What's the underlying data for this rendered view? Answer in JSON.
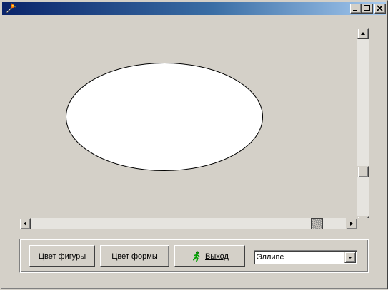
{
  "window": {
    "title": "",
    "controls": [
      "minimize",
      "maximize",
      "close"
    ]
  },
  "drawing_area": {
    "shape": "Ellipse",
    "fill_color": "#ffffff",
    "outline_color": "#000000"
  },
  "scrollbars": {
    "vertical": {
      "thumb_position_fraction": 0.8
    },
    "horizontal": {
      "thumb_position_fraction": 0.95
    }
  },
  "toolbar": {
    "shape_color_label": "Цвет фигуры",
    "form_color_label": "Цвет формы",
    "exit_label": "Выход",
    "exit_icon": "running-man-icon"
  },
  "shape_select": {
    "selected": "Эллипс"
  },
  "colors": {
    "face": "#d4d0c8",
    "title_start": "#0a246a",
    "title_end": "#a6caf0"
  }
}
